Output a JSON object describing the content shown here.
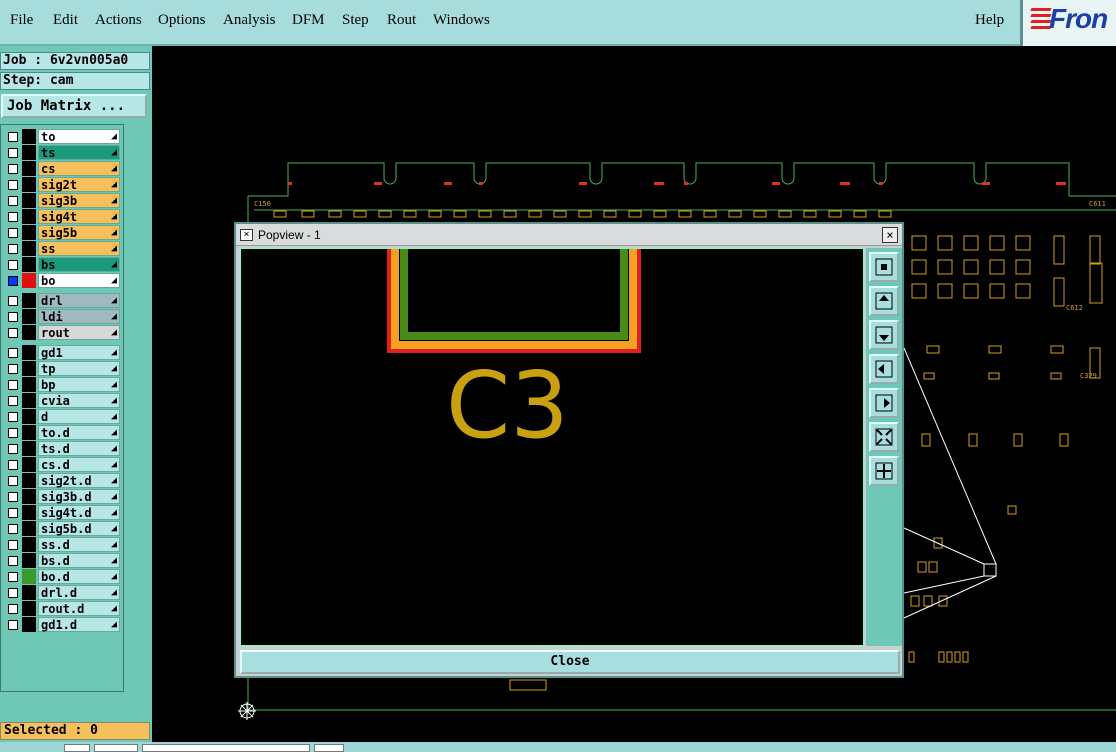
{
  "menu": {
    "file": "File",
    "edit": "Edit",
    "actions": "Actions",
    "options": "Options",
    "analysis": "Analysis",
    "dfm": "DFM",
    "step": "Step",
    "rout": "Rout",
    "windows": "Windows",
    "help": "Help"
  },
  "brand": {
    "logo_text": "Fron"
  },
  "job": {
    "label": "Job : 6v2vn005a0",
    "step": "Step: cam",
    "matrix_button": "Job Matrix ..."
  },
  "layers": [
    {
      "name": "to",
      "color": "#ffffff",
      "state": "off",
      "swatch": ""
    },
    {
      "name": "ts",
      "color": "#1a9a7a",
      "state": "off",
      "swatch": ""
    },
    {
      "name": "cs",
      "color": "#f5c05c",
      "state": "off",
      "swatch": ""
    },
    {
      "name": "sig2t",
      "color": "#f5c05c",
      "state": "off",
      "swatch": ""
    },
    {
      "name": "sig3b",
      "color": "#f5c05c",
      "state": "off",
      "swatch": ""
    },
    {
      "name": "sig4t",
      "color": "#f5c05c",
      "state": "off",
      "swatch": ""
    },
    {
      "name": "sig5b",
      "color": "#f5c05c",
      "state": "off",
      "swatch": ""
    },
    {
      "name": "ss",
      "color": "#f5c05c",
      "state": "off",
      "swatch": ""
    },
    {
      "name": "bs",
      "color": "#1a9a7a",
      "state": "off",
      "swatch": ""
    },
    {
      "name": "bo",
      "color": "#ffffff",
      "state": "on",
      "swatch": "#e01010"
    },
    {
      "name": "drl",
      "color": "#a0b8c0",
      "state": "off",
      "swatch": ""
    },
    {
      "name": "ldi",
      "color": "#a0b8c0",
      "state": "off",
      "swatch": ""
    },
    {
      "name": "rout",
      "color": "#d8d8d8",
      "state": "off",
      "swatch": ""
    },
    {
      "name": "gd1",
      "color": "#b6e6e6",
      "state": "off",
      "swatch": ""
    },
    {
      "name": "tp",
      "color": "#b6e6e6",
      "state": "off",
      "swatch": ""
    },
    {
      "name": "bp",
      "color": "#b6e6e6",
      "state": "off",
      "swatch": ""
    },
    {
      "name": "cvia",
      "color": "#b6e6e6",
      "state": "off",
      "swatch": ""
    },
    {
      "name": "d",
      "color": "#b6e6e6",
      "state": "off",
      "swatch": ""
    },
    {
      "name": "to.d",
      "color": "#b6e6e6",
      "state": "off",
      "swatch": ""
    },
    {
      "name": "ts.d",
      "color": "#b6e6e6",
      "state": "off",
      "swatch": ""
    },
    {
      "name": "cs.d",
      "color": "#b6e6e6",
      "state": "off",
      "swatch": ""
    },
    {
      "name": "sig2t.d",
      "color": "#b6e6e6",
      "state": "off",
      "swatch": ""
    },
    {
      "name": "sig3b.d",
      "color": "#b6e6e6",
      "state": "off",
      "swatch": ""
    },
    {
      "name": "sig4t.d",
      "color": "#b6e6e6",
      "state": "off",
      "swatch": ""
    },
    {
      "name": "sig5b.d",
      "color": "#b6e6e6",
      "state": "off",
      "swatch": ""
    },
    {
      "name": "ss.d",
      "color": "#b6e6e6",
      "state": "off",
      "swatch": ""
    },
    {
      "name": "bs.d",
      "color": "#b6e6e6",
      "state": "off",
      "swatch": ""
    },
    {
      "name": "bo.d",
      "color": "#b6e6e6",
      "state": "off",
      "swatch": "#3a9a2a"
    },
    {
      "name": "drl.d",
      "color": "#b6e6e6",
      "state": "off",
      "swatch": ""
    },
    {
      "name": "rout.d",
      "color": "#b6e6e6",
      "state": "off",
      "swatch": ""
    },
    {
      "name": "gd1.d",
      "color": "#b6e6e6",
      "state": "off",
      "swatch": ""
    }
  ],
  "status": {
    "selected": "Selected : 0"
  },
  "popview": {
    "title": "Popview - 1",
    "close_label": "Close",
    "zoom_text": "C3"
  },
  "canvas": {
    "ref_labels": [
      "C150",
      "C611",
      "C612",
      "C329"
    ]
  },
  "colors": {
    "menubar": "#a6dcdc",
    "panel": "#6fc8b5",
    "board_outline": "#4caf50",
    "silk": "#d4a017"
  }
}
